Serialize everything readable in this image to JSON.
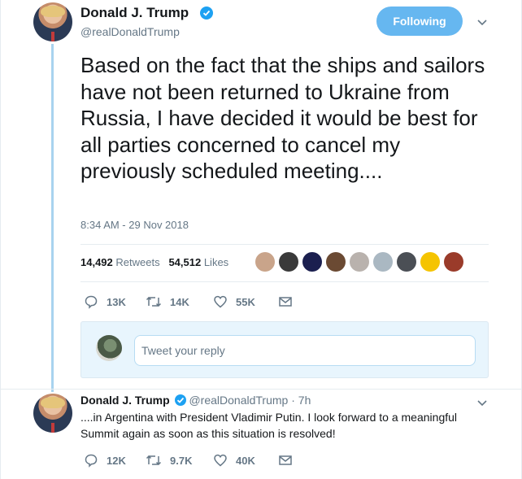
{
  "tweet": {
    "author_name": "Donald J. Trump",
    "author_handle": "@realDonaldTrump",
    "follow_label": "Following",
    "text": "Based on the fact that the ships and sailors have not been returned to Ukraine from Russia, I have decided it would be best for all parties concerned to cancel my previously scheduled meeting....",
    "timestamp": "8:34 AM - 29 Nov 2018",
    "retweets_count": "14,492",
    "retweets_label": "Retweets",
    "likes_count": "54,512",
    "likes_label": "Likes",
    "actions": {
      "replies": "13K",
      "retweets": "14K",
      "likes": "55K"
    }
  },
  "likers": [
    {
      "icon": "liker-avatar-1",
      "color": "#c9a48a"
    },
    {
      "icon": "liker-avatar-2",
      "color": "#3a3a3a"
    },
    {
      "icon": "liker-avatar-3",
      "color": "#1b1f4f"
    },
    {
      "icon": "liker-avatar-4",
      "color": "#6b4a33"
    },
    {
      "icon": "liker-avatar-5",
      "color": "#b9b2ad"
    },
    {
      "icon": "liker-avatar-6",
      "color": "#aab8c2"
    },
    {
      "icon": "liker-avatar-7",
      "color": "#4b4f55"
    },
    {
      "icon": "liker-avatar-8",
      "color": "#f5c400"
    },
    {
      "icon": "liker-avatar-9",
      "color": "#9a3b2a"
    }
  ],
  "reply_box": {
    "placeholder": "Tweet your reply"
  },
  "reply_tweet": {
    "author_name": "Donald J. Trump",
    "author_handle": "@realDonaldTrump",
    "separator": "·",
    "time": "7h",
    "text": "....in Argentina with President Vladimir Putin. I look forward to a meaningful Summit again as soon as this situation is resolved!",
    "actions": {
      "replies": "12K",
      "retweets": "9.7K",
      "likes": "40K"
    }
  },
  "colors": {
    "accent": "#1da1f2",
    "follow_button": "#66b7f0",
    "thread_line": "#a8d3ef",
    "muted_text": "#657786",
    "reply_bg": "#e8f5fd"
  }
}
